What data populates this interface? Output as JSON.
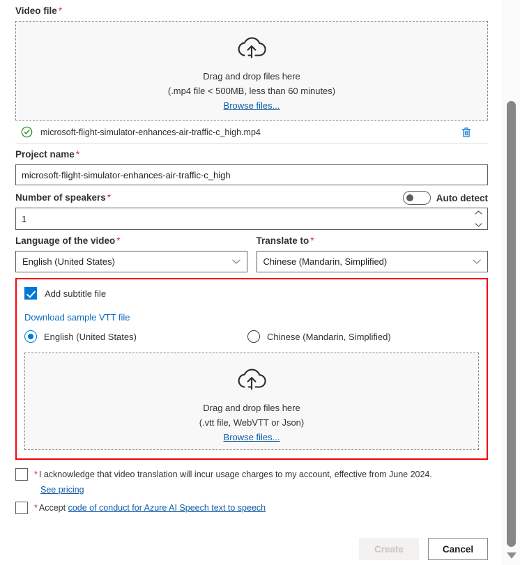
{
  "video_file": {
    "label": "Video file",
    "required_marker": "*",
    "dropzone": {
      "icon": "cloud-upload-icon",
      "line1": "Drag and drop files here",
      "line2": "(.mp4 file < 500MB, less than 60 minutes)",
      "browse": "Browse files..."
    },
    "uploaded": {
      "status_icon": "success-check-icon",
      "name": "microsoft-flight-simulator-enhances-air-traffic-c_high.mp4",
      "delete_icon": "trash-icon"
    }
  },
  "project_name": {
    "label": "Project name",
    "required_marker": "*",
    "value": "microsoft-flight-simulator-enhances-air-traffic-c_high",
    "placeholder": ""
  },
  "speakers": {
    "label": "Number of speakers",
    "required_marker": "*",
    "auto_detect_label": "Auto detect",
    "auto_detect_on": false,
    "value": "1"
  },
  "language_of_video": {
    "label": "Language of the video",
    "required_marker": "*",
    "selected": "English (United States)",
    "chevron": "chevron-down-icon"
  },
  "translate_to": {
    "label": "Translate to",
    "required_marker": "*",
    "selected": "Chinese (Mandarin, Simplified)",
    "chevron": "chevron-down-icon"
  },
  "subtitle_section": {
    "highlight_color": "#fb0007",
    "checkbox_label": "Add subtitle file",
    "checkbox_checked": true,
    "sample_link": "Download sample VTT file",
    "radios": [
      {
        "label": "English (United States)",
        "selected": true
      },
      {
        "label": "Chinese (Mandarin, Simplified)",
        "selected": false
      }
    ],
    "dropzone": {
      "icon": "cloud-upload-icon",
      "line1": "Drag and drop files here",
      "line2": "(.vtt file, WebVTT or Json)",
      "browse": "Browse files..."
    }
  },
  "consent": {
    "acknowledge": {
      "star": "*",
      "text": "I acknowledge that video translation will incur usage charges to my account, effective from June 2024.",
      "checked": false,
      "pricing_link": "See pricing"
    },
    "accept": {
      "star": "*",
      "prefix": "Accept",
      "link_text": "code of conduct for Azure AI Speech text to speech",
      "checked": false
    }
  },
  "footer": {
    "create_label": "Create",
    "create_disabled": true,
    "cancel_label": "Cancel"
  },
  "scrollbar": {
    "down_arrow_icon": "chevron-down-scroll-icon"
  },
  "colors": {
    "accent": "#0078d4",
    "link": "#0f5ba7",
    "required": "#c4314b",
    "highlight": "#fb0007",
    "success": "#107c10"
  }
}
